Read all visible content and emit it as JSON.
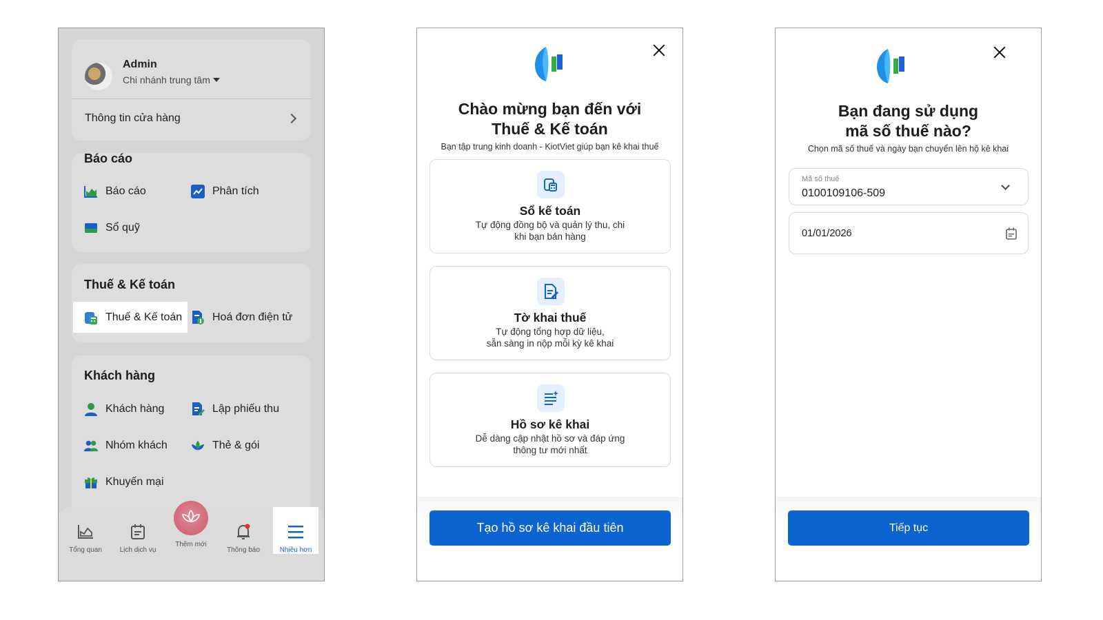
{
  "panel1": {
    "profile": {
      "name": "Admin",
      "branch": "Chi nhánh trung tâm",
      "store_info": "Thông tin cửa hàng"
    },
    "reports": {
      "title": "Báo cáo",
      "items": [
        "Báo cáo",
        "Phân tích",
        "Sổ quỹ"
      ]
    },
    "tax": {
      "title": "Thuế & Kế toán",
      "items": [
        "Thuế & Kế toán",
        "Hoá đơn điện tử"
      ]
    },
    "customers": {
      "title": "Khách hàng",
      "items": [
        "Khách hàng",
        "Lập phiếu thu",
        "Nhóm khách",
        "Thẻ & gói",
        "Khuyến mại"
      ]
    },
    "nav": {
      "overview": "Tổng quan",
      "schedule": "Lịch dịch vụ",
      "add_new": "Thêm mới",
      "notifications": "Thông báo",
      "more": "Nhiều hơn"
    }
  },
  "panel2": {
    "title_line1": "Chào mừng bạn đến với",
    "title_line2": "Thuế & Kế toán",
    "subtitle": "Bạn tập trung kinh doanh - KiotViet giúp bạn kê khai thuế",
    "features": [
      {
        "title": "Sổ kế toán",
        "desc_line1": "Tự động đồng bộ và quản lý thu, chi",
        "desc_line2": "khi bạn bán hàng",
        "icon": "ledger-icon"
      },
      {
        "title": "Tờ khai thuế",
        "desc_line1": "Tự động tổng hợp dữ liệu,",
        "desc_line2": "sẵn sàng in nộp mỗi kỳ kê khai",
        "icon": "tax-form-icon"
      },
      {
        "title": "Hồ sơ kê khai",
        "desc_line1": "Dễ dàng cập nhật hồ sơ và đáp ứng",
        "desc_line2": "thông tư mới nhất",
        "icon": "declaration-list-icon"
      }
    ],
    "cta": "Tạo hồ sơ kê khai đầu tiên"
  },
  "panel3": {
    "title_line1": "Bạn đang sử dụng",
    "title_line2": "mã số thuế nào?",
    "subtitle": "Chọn mã số thuế và ngày bạn chuyển lên hộ kê khai",
    "tax_field": {
      "label": "Mã số thuế",
      "value": "0100109106-509"
    },
    "date_field": {
      "value": "01/01/2026"
    },
    "cta": "Tiếp tục"
  },
  "colors": {
    "primary": "#0c64d1",
    "highlight_nav": "#1561c8",
    "dim_background": "#d5d5d5"
  }
}
